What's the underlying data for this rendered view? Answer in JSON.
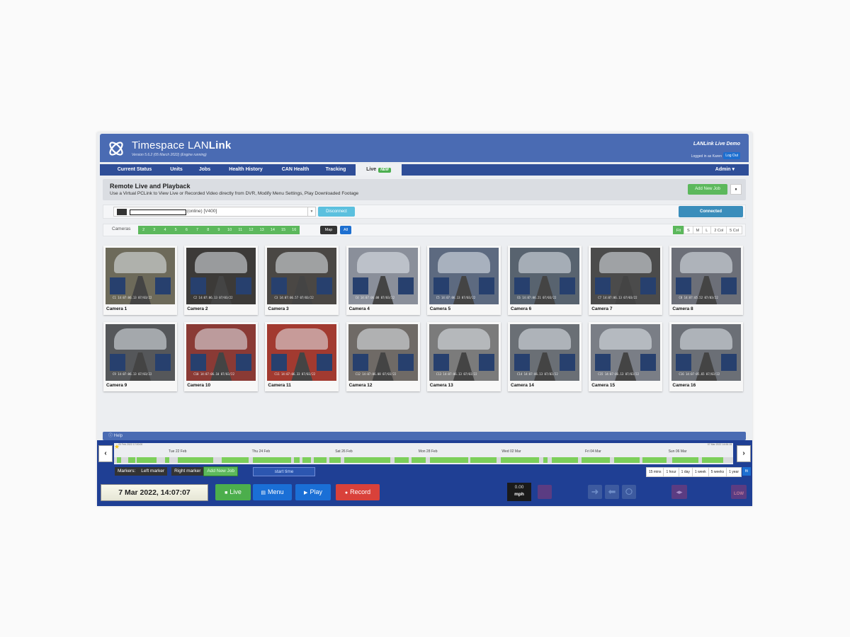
{
  "header": {
    "title_light": "Timespace LAN",
    "title_bold": "Link",
    "version": "Version 5.6.2 (05 March 2022) (Engine running)",
    "demo_name": "LANLink Live Demo",
    "logged_in": "Logged in as Karen",
    "logout_label": "Log Out"
  },
  "nav": {
    "items": [
      "Current Status",
      "Units",
      "Jobs",
      "Health History",
      "CAN Health",
      "Tracking",
      "Live"
    ],
    "new_badge": "NEW",
    "admin": "Admin ▾"
  },
  "panel": {
    "title": "Remote Live and Playback",
    "subtitle": "Use a Virtual PCLink to View Live or Recorded Video directly from DVR, Modify Menu Settings, Play Downloaded Footage",
    "add_job": "Add New Job",
    "pause": "⏸"
  },
  "device": {
    "text": "(online) [V400]",
    "disconnect": "Disconnect",
    "status": "Connected"
  },
  "cameras": {
    "label": "Cameras",
    "numbers": [
      "2",
      "3",
      "4",
      "5",
      "6",
      "7",
      "8",
      "9",
      "10",
      "11",
      "12",
      "13",
      "14",
      "15",
      "16"
    ],
    "map": "Map",
    "all": "All",
    "sizes": [
      "Fit",
      "S",
      "M",
      "L",
      "2 Col",
      "5 Col"
    ],
    "active_size": "Fit",
    "tiles": [
      {
        "name": "Camera 1",
        "ts": "C1   14:07:06.13  07/03/22"
      },
      {
        "name": "Camera 2",
        "ts": "C2   14:07:06.13  07/03/22"
      },
      {
        "name": "Camera 3",
        "ts": "C3   14:07:06.57  07/03/22"
      },
      {
        "name": "Camera 4",
        "ts": "C4   14:07:06.08  07/03/22"
      },
      {
        "name": "Camera 5",
        "ts": "C5   14:07:06.13  07/03/22"
      },
      {
        "name": "Camera 6",
        "ts": "C6   14:07:06.21  07/03/22"
      },
      {
        "name": "Camera 7",
        "ts": "C7   14:07:06.13  07/03/22"
      },
      {
        "name": "Camera 8",
        "ts": "C8   14:07:05.52  07/03/22"
      },
      {
        "name": "Camera 9",
        "ts": "C9   14:07:06.13  07/03/22"
      },
      {
        "name": "Camera 10",
        "ts": "C10  14:07:06.10  07/03/22"
      },
      {
        "name": "Camera 11",
        "ts": "C11  14:07:06.33  07/03/22"
      },
      {
        "name": "Camera 12",
        "ts": "C12  14:07:06.08  07/03/22"
      },
      {
        "name": "Camera 13",
        "ts": "C13  14:07:06.13  07/03/22"
      },
      {
        "name": "Camera 14",
        "ts": "C14  14:07:06.13  07/03/22"
      },
      {
        "name": "Camera 15",
        "ts": "C15  14:07:06.13  07/03/22"
      },
      {
        "name": "Camera 16",
        "ts": "C16  14:07:05.65  07/03/22"
      }
    ]
  },
  "help": "Help",
  "timeline": {
    "start": "20 Feb 2022 17:00:00",
    "end": "07 Mar 2022 14:06:13",
    "dates": [
      "Tue 22 Feb",
      "Thu 24 Feb",
      "Sat 26 Feb",
      "Mon 28 Feb",
      "Wed 02 Mar",
      "Fri 04 Mar",
      "Sun 06 Mar"
    ],
    "markers_label": "Markers:",
    "left_marker": "Left marker",
    "right_marker": "Right marker",
    "add_job": "Add New Job",
    "start_time": "start time",
    "ranges": [
      "15 mins",
      "1 hour",
      "1 day",
      "1 week",
      "5 weeks",
      "1 year"
    ],
    "fit": "fit"
  },
  "controls": {
    "datetime": "7 Mar 2022, 14:07:07",
    "live": "Live",
    "menu": "Menu",
    "play": "Play",
    "record": "Record",
    "speed_value": "0.00",
    "speed_unit": "mph",
    "low": "LOW",
    "colors": {
      "live": "#4cae4c",
      "menu": "#1a6fd6",
      "play": "#1a6fd6",
      "record": "#d9413a"
    }
  }
}
